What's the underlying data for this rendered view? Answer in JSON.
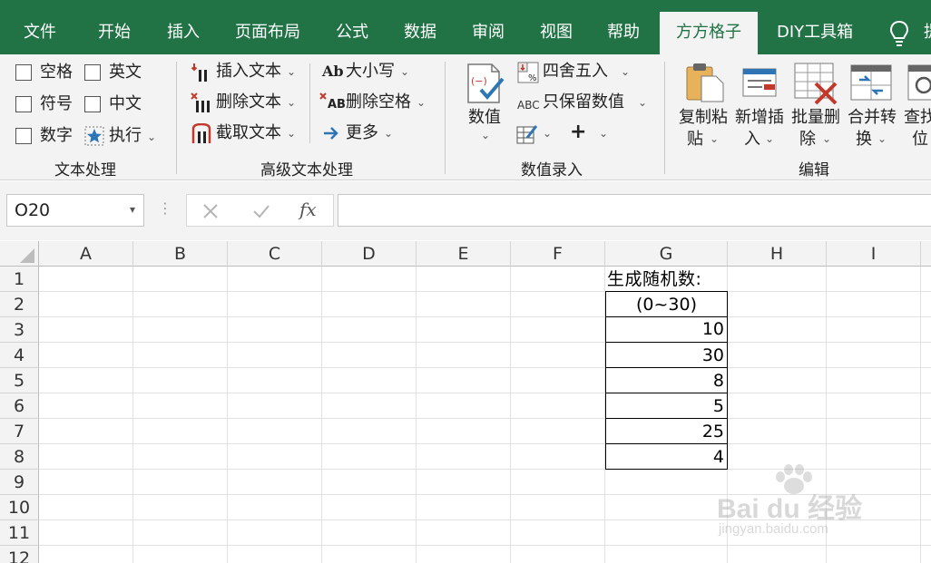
{
  "tabs": [
    "文件",
    "开始",
    "插入",
    "页面布局",
    "公式",
    "数据",
    "审阅",
    "视图",
    "帮助",
    "方方格子",
    "DIY工具箱",
    "提"
  ],
  "active_tab": "方方格子",
  "ribbon": {
    "text_group": {
      "options": [
        "空格",
        "英文",
        "符号",
        "中文",
        "数字"
      ],
      "execute": "执行",
      "label": "文本处理"
    },
    "advanced_group": {
      "insert_text": "插入文本",
      "delete_text": "删除文本",
      "extract_text": "截取文本",
      "case": "大小写",
      "case_icon": "Ab",
      "delete_spaces": "删除空格",
      "delete_spaces_icon": "AB",
      "more": "更多",
      "label": "高级文本处理"
    },
    "number_group": {
      "number": "数值",
      "round": "四舍五入",
      "keep_values": "只保留数值",
      "keep_values_icon": "ABC",
      "plus": "+",
      "label": "数值录入"
    },
    "edit_group": {
      "copy_paste": [
        "复制粘",
        "贴"
      ],
      "insert_new": [
        "新增插",
        "入"
      ],
      "batch_delete": [
        "批量删",
        "除"
      ],
      "merge_convert": [
        "合并转",
        "换"
      ],
      "find_position": [
        "查找",
        "位"
      ],
      "label": "编辑"
    }
  },
  "formula_bar": {
    "name_box": "O20",
    "fx": "fx",
    "value": ""
  },
  "columns": [
    "A",
    "B",
    "C",
    "D",
    "E",
    "F",
    "G",
    "H",
    "I"
  ],
  "rows": [
    "1",
    "2",
    "3",
    "4",
    "5",
    "6",
    "7",
    "8",
    "9",
    "10",
    "11",
    "12"
  ],
  "cells_G": {
    "title": "生成随机数:",
    "range": "(0~30)",
    "values": [
      "10",
      "30",
      "8",
      "5",
      "25",
      "4"
    ]
  },
  "watermark": {
    "brand": "Bai du 经验",
    "url": "jingyan.baidu.com"
  },
  "colors": {
    "tab_bar": "#217346",
    "ribbon_bg": "#f3f3f3",
    "delete_red": "#c0392b",
    "accent_blue": "#2e75b6"
  }
}
